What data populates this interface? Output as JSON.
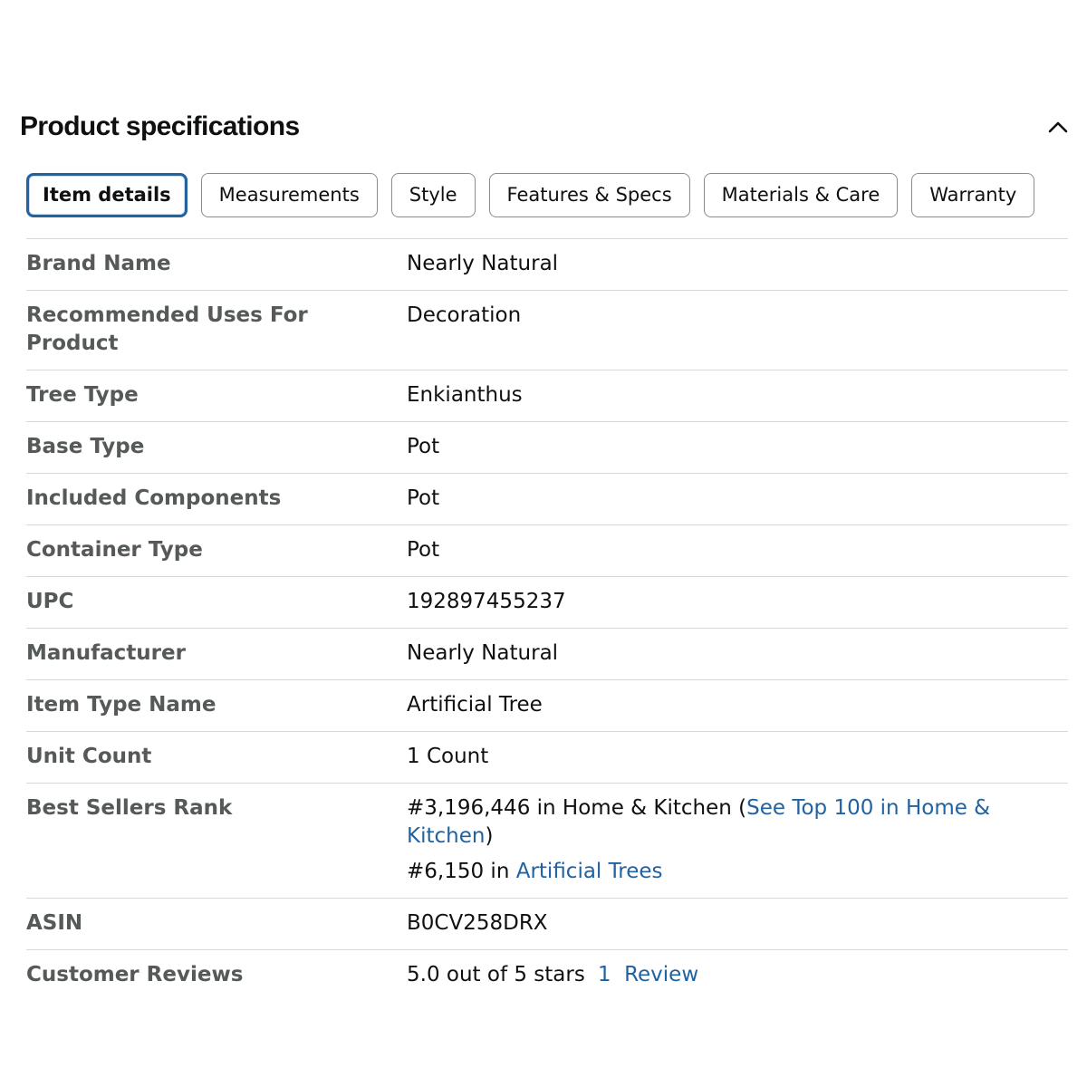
{
  "header": {
    "title": "Product specifications",
    "collapse_icon": "chevron-up-icon"
  },
  "tabs": [
    {
      "label": "Item details",
      "active": true
    },
    {
      "label": "Measurements",
      "active": false
    },
    {
      "label": "Style",
      "active": false
    },
    {
      "label": "Features & Specs",
      "active": false
    },
    {
      "label": "Materials & Care",
      "active": false
    },
    {
      "label": "Warranty",
      "active": false
    }
  ],
  "specs": {
    "brand_name": {
      "label": "Brand Name",
      "value": "Nearly Natural"
    },
    "recommended_uses": {
      "label": "Recommended Uses For Product",
      "value": "Decoration"
    },
    "tree_type": {
      "label": "Tree Type",
      "value": "Enkianthus"
    },
    "base_type": {
      "label": "Base Type",
      "value": "Pot"
    },
    "included_components": {
      "label": "Included Components",
      "value": "Pot"
    },
    "container_type": {
      "label": "Container Type",
      "value": "Pot"
    },
    "upc": {
      "label": "UPC",
      "value": "192897455237"
    },
    "manufacturer": {
      "label": "Manufacturer",
      "value": "Nearly Natural"
    },
    "item_type_name": {
      "label": "Item Type Name",
      "value": "Artificial Tree"
    },
    "unit_count": {
      "label": "Unit Count",
      "value": "1 Count"
    },
    "best_sellers_rank": {
      "label": "Best Sellers Rank",
      "line1_text": "#3,196,446 in Home & Kitchen (",
      "line1_link": "See Top 100 in Home & Kitchen",
      "line1_close": ")",
      "line2_text": "#6,150 in ",
      "line2_link": "Artificial Trees"
    },
    "asin": {
      "label": "ASIN",
      "value": "B0CV258DRX"
    },
    "customer_reviews": {
      "label": "Customer Reviews",
      "value": "5.0 out of 5 stars",
      "link": "1  Review"
    }
  },
  "colors": {
    "link": "#2162a1",
    "label": "#565959",
    "active_tab_border": "#2162a1",
    "divider": "#d5d9d9"
  }
}
